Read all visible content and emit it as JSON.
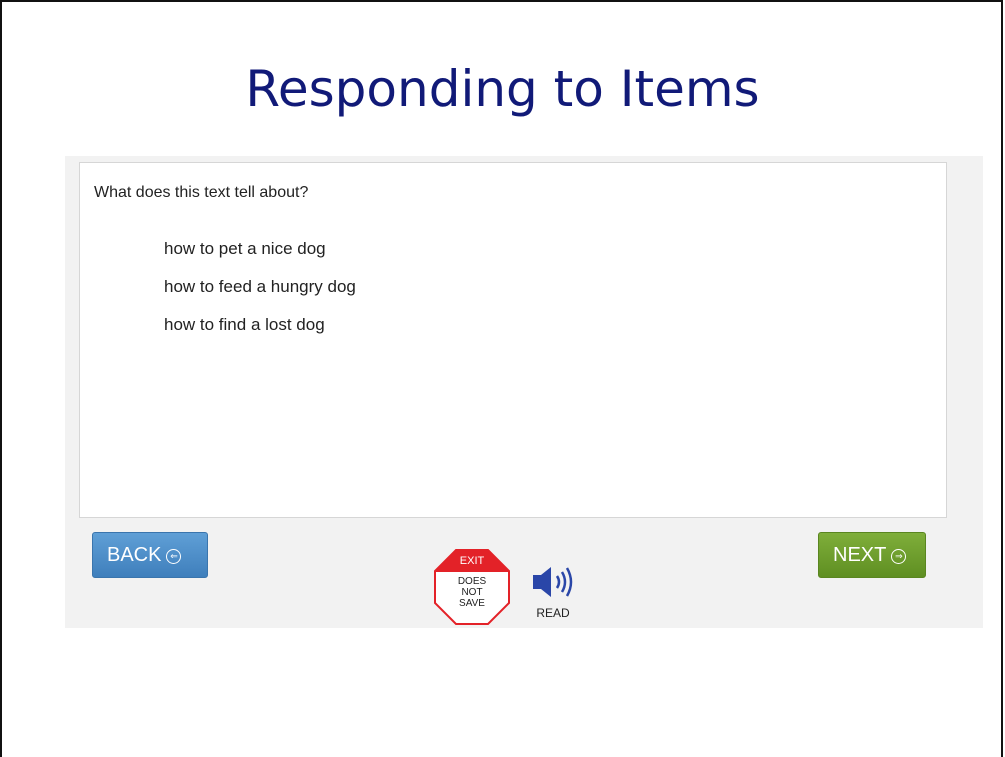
{
  "slide": {
    "title": "Responding to Items"
  },
  "question": {
    "prompt": "What does this text tell about?",
    "options": [
      "how to pet a nice dog",
      "how to feed a hungry dog",
      "how to find a lost dog"
    ]
  },
  "nav": {
    "back_label": "BACK",
    "next_label": "NEXT"
  },
  "tools": {
    "exit_label": "EXIT",
    "exit_note_1": "DOES",
    "exit_note_2": "NOT",
    "exit_note_3": "SAVE",
    "read_label": "READ"
  },
  "colors": {
    "title": "#111a78",
    "back_button": "#4a8ac6",
    "next_button": "#6c9c2c",
    "exit_red": "#e32228"
  },
  "icons": {
    "back": "arrow-left-circle-icon",
    "next": "arrow-right-circle-icon",
    "exit": "stop-sign-icon",
    "read": "speaker-icon"
  }
}
